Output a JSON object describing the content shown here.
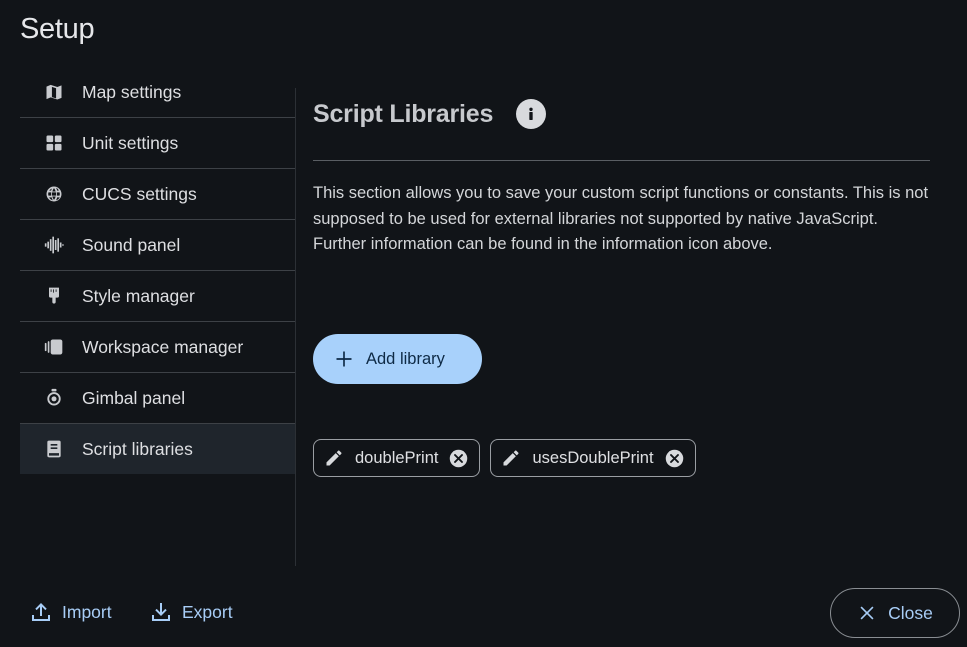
{
  "window": {
    "title": "Setup"
  },
  "sidebar": {
    "items": [
      {
        "label": "Map settings",
        "icon": "map-icon"
      },
      {
        "label": "Unit settings",
        "icon": "grid-icon"
      },
      {
        "label": "CUCS settings",
        "icon": "globe-icon"
      },
      {
        "label": "Sound panel",
        "icon": "waveform-icon"
      },
      {
        "label": "Style manager",
        "icon": "brush-icon"
      },
      {
        "label": "Workspace manager",
        "icon": "workspace-icon"
      },
      {
        "label": "Gimbal panel",
        "icon": "gimbal-icon"
      },
      {
        "label": "Script libraries",
        "icon": "book-icon",
        "active": true
      }
    ]
  },
  "content": {
    "title": "Script Libraries",
    "info_icon": "info-icon",
    "description": "This section allows you to save your custom script functions or constants. This is not supposed to be used for external libraries not supported by native JavaScript. Further information can be found in the information icon above.",
    "add_button_label": "Add library",
    "libraries": [
      {
        "name": "doublePrint"
      },
      {
        "name": "usesDoublePrint"
      }
    ]
  },
  "footer": {
    "import_label": "Import",
    "export_label": "Export",
    "close_label": "Close"
  },
  "colors": {
    "background": "#111418",
    "accent": "#a8d1fb",
    "active_item": "#1f252c"
  }
}
